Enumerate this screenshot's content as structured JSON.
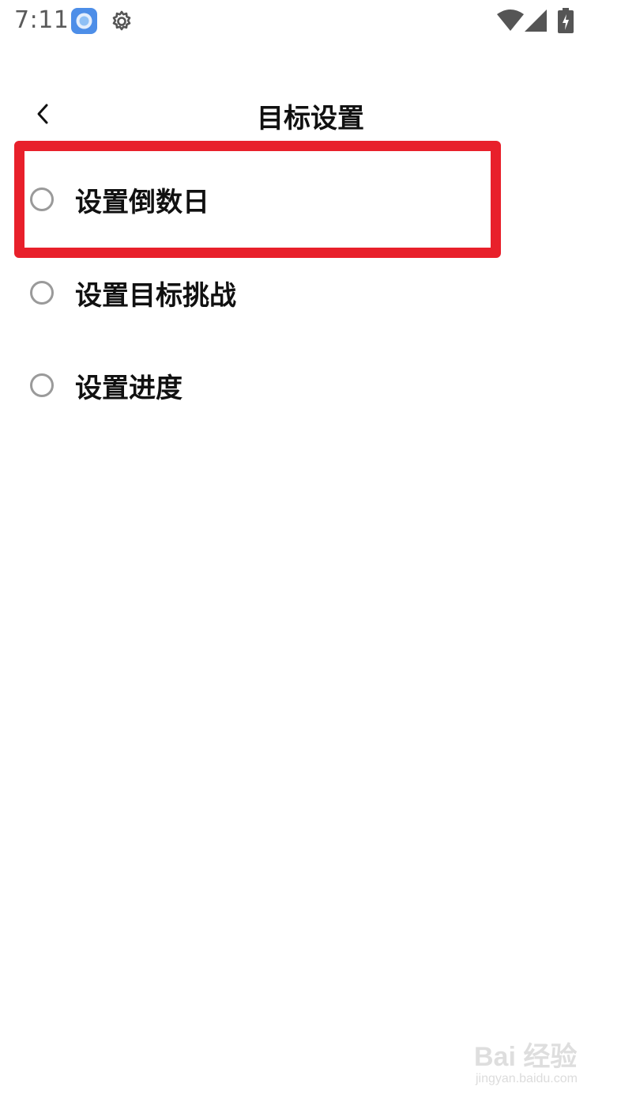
{
  "status_bar": {
    "time": "7:11",
    "icons": [
      "app-icon",
      "gear-icon",
      "wifi-icon",
      "signal-icon",
      "battery-charging-icon"
    ]
  },
  "header": {
    "title": "目标设置",
    "back_icon": "chevron-left-icon"
  },
  "options": [
    {
      "label": "设置倒数日",
      "selected": false,
      "highlighted": true
    },
    {
      "label": "设置目标挑战",
      "selected": false,
      "highlighted": false
    },
    {
      "label": "设置进度",
      "selected": false,
      "highlighted": false
    }
  ],
  "colors": {
    "highlight": "#e8202b",
    "radio_border": "#9a9a9a",
    "text": "#111111",
    "status_text": "#5a5a5a"
  },
  "watermark": {
    "logo": "Bai 经验",
    "url": "jingyan.baidu.com"
  }
}
